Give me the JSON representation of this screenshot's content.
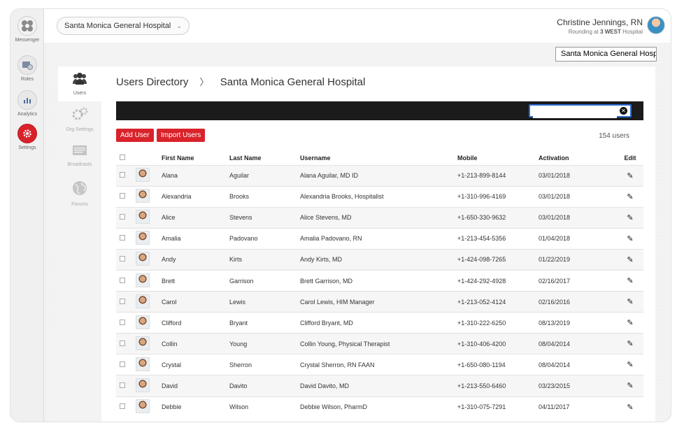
{
  "rail": [
    {
      "label": "Messenger",
      "icon": "messenger-icon"
    },
    {
      "label": "Roles",
      "icon": "roles-icon"
    },
    {
      "label": "Analytics",
      "icon": "analytics-icon"
    },
    {
      "label": "Settings",
      "icon": "settings-icon"
    }
  ],
  "header": {
    "hospital_select": "Santa Monica General Hospital",
    "user_name": "Christine Jennings, RN",
    "rounding_prefix": "Rounding at",
    "rounding_unit": "3 WEST",
    "rounding_suffix": "Hospital",
    "hospital_box": "Santa Monica General Hospital"
  },
  "subnav": [
    {
      "label": "Users",
      "icon": "users-icon"
    },
    {
      "label": "Org Settings",
      "icon": "gears-icon"
    },
    {
      "label": "Broadcasts",
      "icon": "broadcast-icon"
    },
    {
      "label": "Forums",
      "icon": "globe-icon"
    }
  ],
  "breadcrumb": {
    "root": "Users Directory",
    "sep": "〉",
    "current": "Santa Monica General Hospital"
  },
  "actions": {
    "add_user": "Add User",
    "import_users": "Import Users",
    "count": "154 users"
  },
  "search": {
    "placeholder": "",
    "clear": "✕"
  },
  "columns": [
    "First Name",
    "Last Name",
    "Username",
    "Mobile",
    "Activation",
    "Edit"
  ],
  "rows": [
    {
      "first": "Alana",
      "last": "Aguilar",
      "username": "Alana Aguilar, MD ID",
      "mobile": "+1-213-899-8144",
      "activation": "03/01/2018"
    },
    {
      "first": "Alexandria",
      "last": "Brooks",
      "username": "Alexandria Brooks, Hospitalist",
      "mobile": "+1-310-996-4169",
      "activation": "03/01/2018"
    },
    {
      "first": "Alice",
      "last": "Stevens",
      "username": "Alice Stevens, MD",
      "mobile": "+1-650-330-9632",
      "activation": "03/01/2018"
    },
    {
      "first": "Amalia",
      "last": "Padovano",
      "username": "Amalia Padovano, RN",
      "mobile": "+1-213-454-5356",
      "activation": "01/04/2018"
    },
    {
      "first": "Andy",
      "last": "Kirts",
      "username": "Andy Kirts, MD",
      "mobile": "+1-424-098-7265",
      "activation": "01/22/2019"
    },
    {
      "first": "Brett",
      "last": "Garrison",
      "username": "Brett Garrison, MD",
      "mobile": "+1-424-292-4928",
      "activation": "02/16/2017"
    },
    {
      "first": "Carol",
      "last": "Lewis",
      "username": "Carol Lewis, HIM Manager",
      "mobile": "+1-213-052-4124",
      "activation": "02/16/2016"
    },
    {
      "first": "Clifford",
      "last": "Bryant",
      "username": "Clifford Bryant, MD",
      "mobile": "+1-310-222-6250",
      "activation": "08/13/2019"
    },
    {
      "first": "Collin",
      "last": "Young",
      "username": "Collin Young, Physical Therapist",
      "mobile": "+1-310-406-4200",
      "activation": "08/04/2014"
    },
    {
      "first": "Crystal",
      "last": "Sherron",
      "username": "Crystal Sherron, RN FAAN",
      "mobile": "+1-650-080-1194",
      "activation": "08/04/2014"
    },
    {
      "first": "David",
      "last": "Davito",
      "username": "David Davito, MD",
      "mobile": "+1-213-550-6460",
      "activation": "03/23/2015"
    },
    {
      "first": "Debbie",
      "last": "Wilson",
      "username": "Debbie Wilson, PharmD",
      "mobile": "+1-310-075-7291",
      "activation": "04/11/2017"
    }
  ],
  "edit_icon": "pencil-icon",
  "colors": {
    "accent": "#d9222a",
    "bar": "#1b1b1b",
    "search_border": "#2a6bd1"
  }
}
